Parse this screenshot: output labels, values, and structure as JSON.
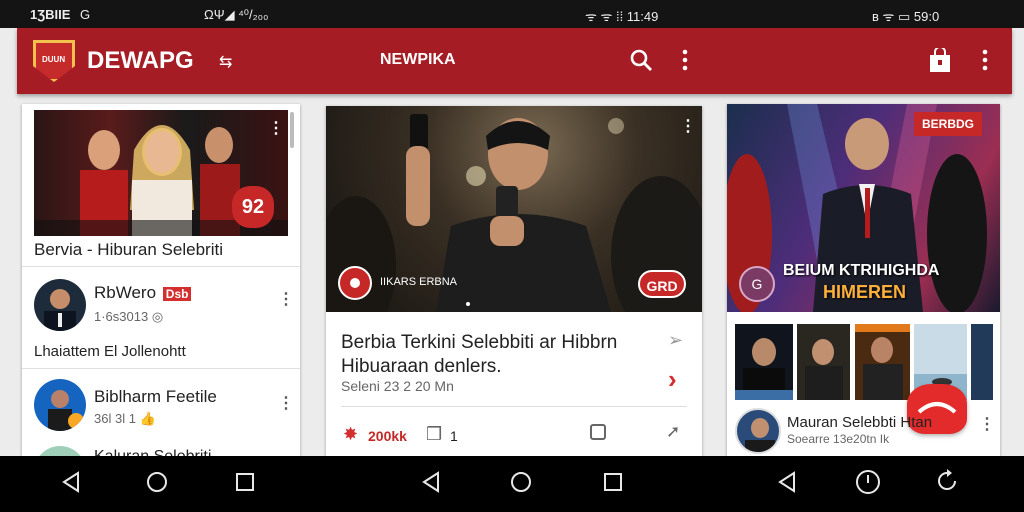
{
  "status": {
    "left_time": "1ƷBIIE",
    "left_indicator": "G",
    "left_mid": "ΩΨ◢ ⁴⁰/₂₀₀",
    "right_mid": "ᯤ ᯤ ⁞⁞ 11:49",
    "far_right": "ʙ ᯤ ▭ 59:0"
  },
  "appbar": {
    "brand": "DEWAPG",
    "logo_text": "DUUN",
    "center_title": "NEWPIKA"
  },
  "left_card": {
    "image_badge": "92",
    "title": "Bervia - Hiburan Selebriti",
    "row1": {
      "name": "RbWero",
      "tag": "Dsb",
      "meta": "1·6s3013"
    },
    "row_text": "Lhaiattem El Jollenohtt",
    "row2": {
      "name": "Biblharm Feetile",
      "meta": "36l 3l 1"
    },
    "row3": {
      "name": "Kaluran Selebriti"
    }
  },
  "mid_card": {
    "overlay_label": "IIKARS ERBNA",
    "badge": "GRD",
    "headline_line1": "Berbia Terkini Selebbiti ar Hibbrn",
    "headline_line2": "Hibuaraan denlers.",
    "sub": "Seleni 23 2 20 Mn",
    "like_count": "200kk",
    "comment_count": "1"
  },
  "right_card": {
    "tag": "BERBDG",
    "hero_line1": "BEIUM KTRIHIGHDA",
    "hero_line2": "HIMEREN",
    "play_label": "G",
    "list_title": "Mauran Selebbti Htan",
    "list_meta": "Soearre 13e20tn Ik"
  }
}
